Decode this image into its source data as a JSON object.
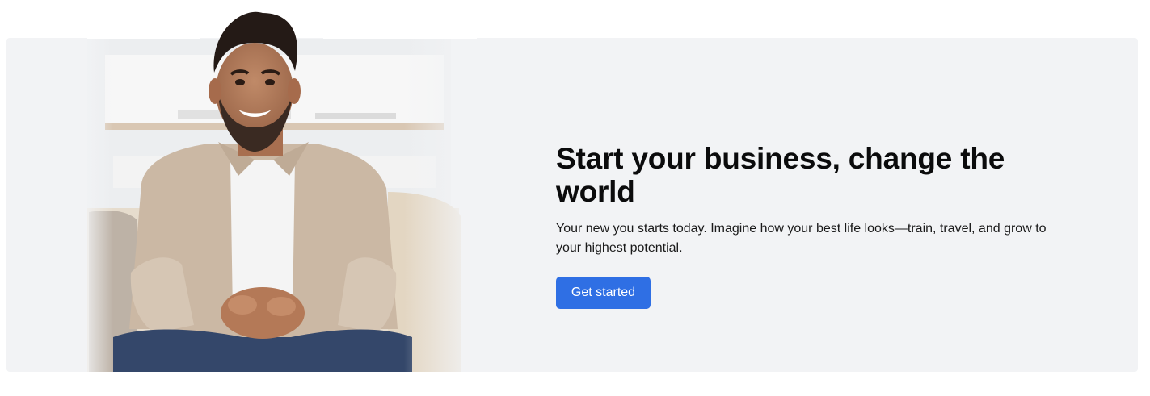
{
  "hero": {
    "title": "Start your business, change the world",
    "subtitle": "Your new you starts today. Imagine how your best life looks—train, travel, and grow to your highest potential.",
    "cta_label": "Get started",
    "colors": {
      "panel_background": "#f2f3f5",
      "button_background": "#2f6fe4",
      "button_text": "#ffffff",
      "title_text": "#0b0b0c"
    },
    "image": "smiling-man-sitting-on-sofa"
  }
}
